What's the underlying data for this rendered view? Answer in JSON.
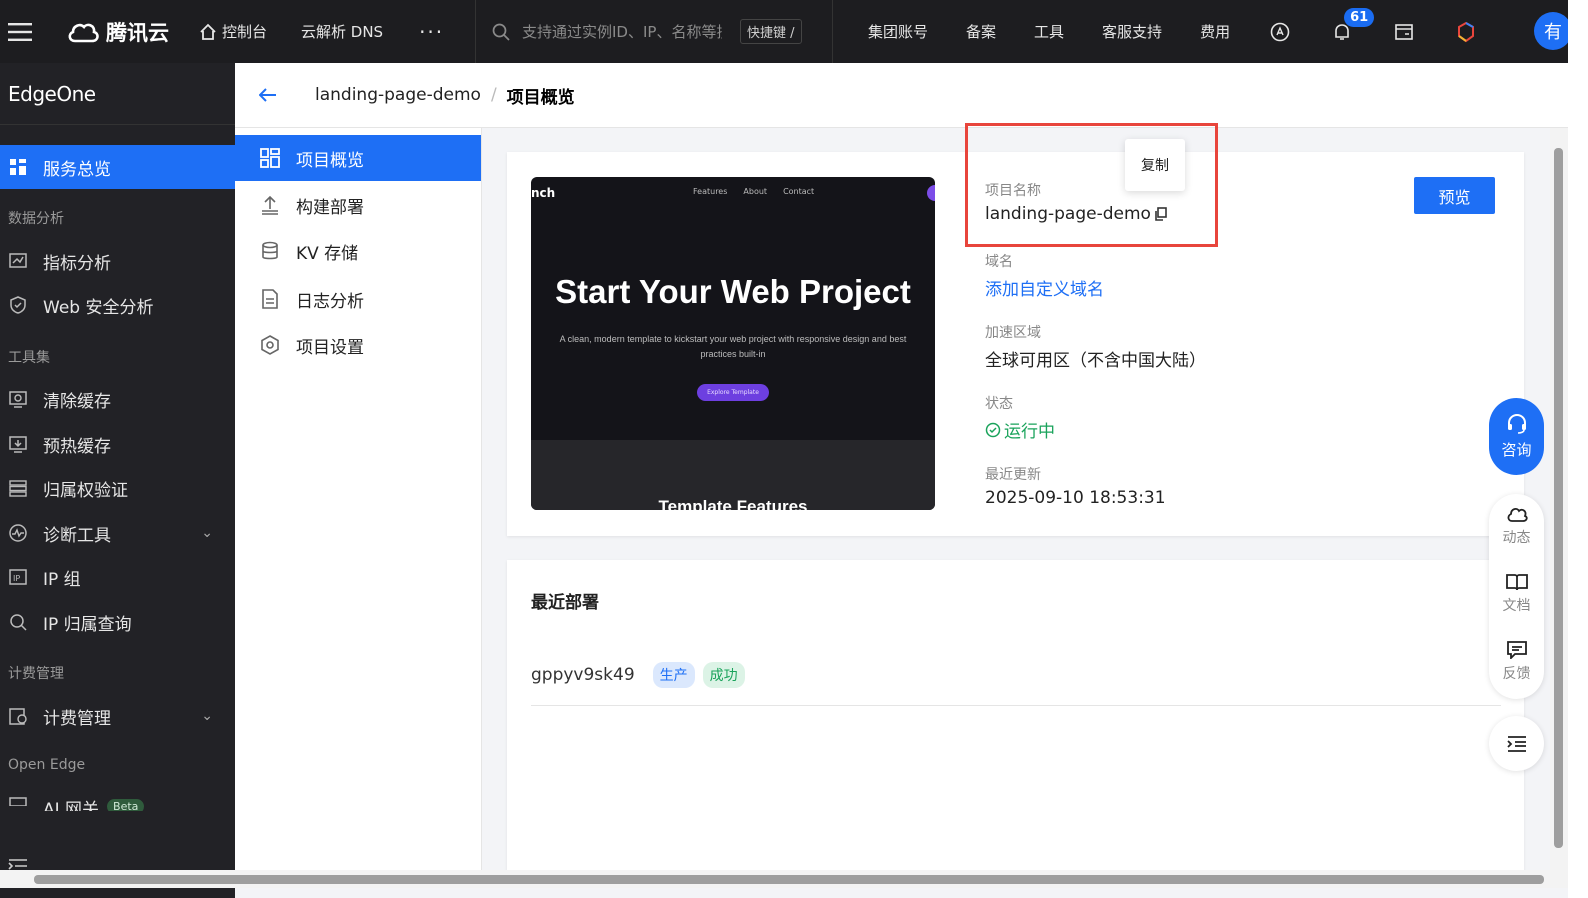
{
  "topbar": {
    "brand": "腾讯云",
    "console": "控制台",
    "dns": "云解析 DNS",
    "more": "···",
    "search_placeholder": "支持通过实例ID、IP、名称等搜",
    "shortcut": "快捷键 /",
    "links": [
      "集团账号",
      "备案",
      "工具",
      "客服支持",
      "费用"
    ],
    "notification_count": "61",
    "avatar": "有"
  },
  "sidebar": {
    "title": "EdgeOne",
    "active_item": "服务总览",
    "groups": {
      "data": "数据分析",
      "tools": "工具集",
      "billing": "计费管理",
      "open": "Open Edge"
    },
    "items": {
      "metrics": "指标分析",
      "websec": "Web 安全分析",
      "purge": "清除缓存",
      "prefetch": "预热缓存",
      "ownership": "归属权验证",
      "diagnose": "诊断工具",
      "ipgroup": "IP 组",
      "iplookup": "IP 归属查询",
      "billing": "计费管理",
      "aigw": "AI 网关",
      "beta": "Beta"
    }
  },
  "breadcrumb": {
    "project": "landing-page-demo",
    "separator": "/",
    "current": "项目概览"
  },
  "subnav": [
    "项目概览",
    "构建部署",
    "KV 存储",
    "日志分析",
    "项目设置"
  ],
  "overview": {
    "thumb": {
      "brand": "nch",
      "nav": [
        "Features",
        "About",
        "Contact"
      ],
      "hero": "Start Your Web Project",
      "sub": "A clean, modern template to kickstart your web project with responsive design and best practices built-in",
      "button": "Explore Template",
      "features": "Template Features"
    },
    "name_label": "项目名称",
    "name_value": "landing-page-demo",
    "copy_tooltip": "复制",
    "domain_label": "域名",
    "domain_value": "添加自定义域名",
    "region_label": "加速区域",
    "region_value": "全球可用区（不含中国大陆）",
    "status_label": "状态",
    "status_value": "运行中",
    "updated_label": "最近更新",
    "updated_value": "2025-09-10 18:53:31",
    "preview_button": "预览"
  },
  "deploy": {
    "title": "最近部署",
    "id": "gppyv9sk49",
    "env_tag": "生产",
    "status_tag": "成功"
  },
  "floating": {
    "consult": "咨询",
    "news": "动态",
    "docs": "文档",
    "feedback": "反馈"
  }
}
